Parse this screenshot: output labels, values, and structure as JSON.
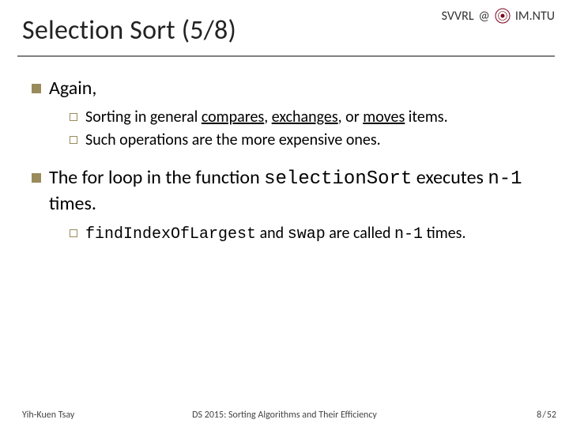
{
  "header": {
    "brand_left": "SVVRL",
    "brand_at": "@",
    "brand_right": "IM.NTU",
    "title": "Selection Sort (5/8)"
  },
  "content": {
    "p1": {
      "text": "Again,",
      "sub": [
        {
          "pre": "Sorting in general ",
          "u1": "compares",
          "mid1": ", ",
          "u2": "exchanges",
          "mid2": ", or ",
          "u3": "moves",
          "post": " items."
        },
        {
          "text": "Such operations are the more expensive ones."
        }
      ]
    },
    "p2": {
      "pre": "The for loop in the function ",
      "code1": "selectionSort",
      "mid": " executes ",
      "code2": "n-1",
      "post": " times.",
      "sub": [
        {
          "code1": "findIndexOfLargest",
          "mid1": " and ",
          "code2": "swap",
          "mid2": " are called ",
          "code3": "n-1",
          "post": " times."
        }
      ]
    }
  },
  "footer": {
    "author": "Yih-Kuen Tsay",
    "course": "DS 2015: Sorting Algorithms and Their Efficiency",
    "page_current": "8",
    "page_sep": "/",
    "page_total": "52"
  }
}
